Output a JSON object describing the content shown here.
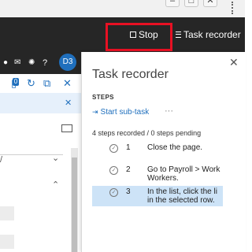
{
  "browser": {
    "minimize_glyph": "–",
    "maximize_glyph": "□",
    "close_glyph": "✕"
  },
  "app_header": {
    "stop_label": "Stop",
    "task_recorder_label": "Task recorder"
  },
  "left_strip": {
    "avatar_initials": "D3",
    "badge_count": "0"
  },
  "task_recorder": {
    "title": "Task recorder",
    "close_glyph": "✕",
    "steps_heading": "STEPS",
    "start_subtask_label": "Start sub-task",
    "more_glyph": "···",
    "summary": "4 steps recorded / 0 steps pending",
    "steps": [
      {
        "number": "1",
        "text": "Close the page."
      },
      {
        "number": "2",
        "text": "Go to Payroll > Work\nWorkers."
      },
      {
        "number": "3",
        "text": "In the list, click the li\nin the selected row."
      }
    ]
  },
  "colors": {
    "header_bg": "#262626",
    "accent_blue": "#1f6fbd",
    "highlight_red": "#e81123",
    "selected_row": "#cde3f7"
  }
}
